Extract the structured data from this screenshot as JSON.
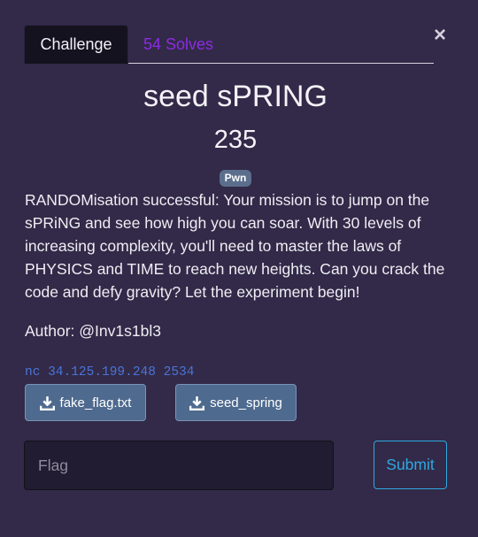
{
  "tabs": {
    "challenge": "Challenge",
    "solves": "54 Solves"
  },
  "close_label": "×",
  "challenge": {
    "name": "seed sPRING",
    "points": "235",
    "category": "Pwn",
    "description": "RANDOMisation successful: Your mission is to jump on the sPRiNG and see how high you can soar. With 30 levels of increasing complexity, you'll need to master the laws of PHYSICS and TIME to reach new heights. Can you crack the code and defy gravity? Let the experiment begin!",
    "author": "Author: @Inv1s1bl3",
    "connection": "nc 34.125.199.248 2534"
  },
  "files": [
    {
      "label": "fake_flag.txt",
      "icon": "download-icon"
    },
    {
      "label": "seed_spring",
      "icon": "download-icon"
    }
  ],
  "form": {
    "flag_placeholder": "Flag",
    "flag_value": "",
    "submit_label": "Submit"
  },
  "colors": {
    "background": "#322a48",
    "tab_active": "#15121f",
    "solves_link": "#8d2be2",
    "badge": "#5b6e8c",
    "connection_text": "#4a74d8",
    "file_button": "#4e6a8e",
    "submit_accent": "#2fa8e0"
  }
}
